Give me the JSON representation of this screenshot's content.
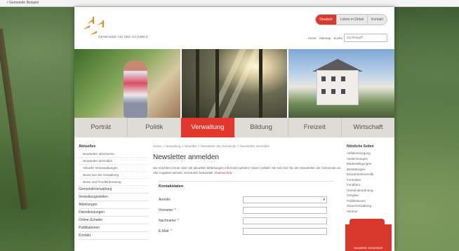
{
  "browser": {
    "top_text": "• Gemeinde Beispiel"
  },
  "header": {
    "logo_text": "GEMEINDE AM SEE SCHWEIZ",
    "lang_options": [
      "Deutsch",
      "Leben in Detail",
      "Kontakt"
    ],
    "util_links": [
      "Home",
      "Sitemap",
      "Suche"
    ],
    "search_placeholder": "Suchbegriff"
  },
  "nav": {
    "items": [
      "Porträt",
      "Politik",
      "Verwaltung",
      "Bildung",
      "Freizeit",
      "Wirtschaft"
    ],
    "active": "Verwaltung"
  },
  "sidebar": {
    "heading": "Aktuelles",
    "sub_items": [
      "Newsletter abonnieren",
      "Newsletter anmelden",
      "Aktuelle Veranstaltungen",
      "News aus der Verwaltung",
      "News und Pendlerberatung"
    ],
    "main_items": [
      "Gemeindeverwaltung",
      "Verwaltungsstellen",
      "Abteilungen",
      "Dienstleistungen",
      "Online-Schalter",
      "Publikationen",
      "Kontakt"
    ]
  },
  "breadcrumb": "Home  >  Verwaltung  >  Aktuelles  >  Newsletter der Gemeinde  >  Newsletter anmelden",
  "main": {
    "title": "Newsletter anmelden",
    "intro": "Sie möchten immer über die aktuellen Mitteilungen informiert werden? Dann melden Sie sich hier für den Newsletter der Gemeinde an. Alle Angaben werden vertraulich behandelt.",
    "intro_link": "Datenschutz"
  },
  "form": {
    "heading": "Kontaktdaten",
    "fields": [
      {
        "label": "Anrede:",
        "value": ""
      },
      {
        "label": "Vorname: *",
        "value": ""
      },
      {
        "label": "Nachname: *",
        "value": ""
      },
      {
        "label": "E-Mail: *",
        "value": ""
      }
    ]
  },
  "rightbar": {
    "heading": "Nützliche Seiten",
    "items": [
      "Abfallentsorgung",
      "Abstimmungen",
      "Baubewilligungen",
      "Bestattungen",
      "Einwohnerkontrolle",
      "Formulare",
      "Fundbüro",
      "Gemeindeordnung",
      "Ortsplan",
      "Publikationen",
      "Steuerverwaltung",
      "Vereine"
    ]
  },
  "promo": {
    "label": "SAUBERE GEMEINDE"
  },
  "colors": {
    "accent": "#d9382d",
    "nav_bg": "#dddcd7"
  }
}
